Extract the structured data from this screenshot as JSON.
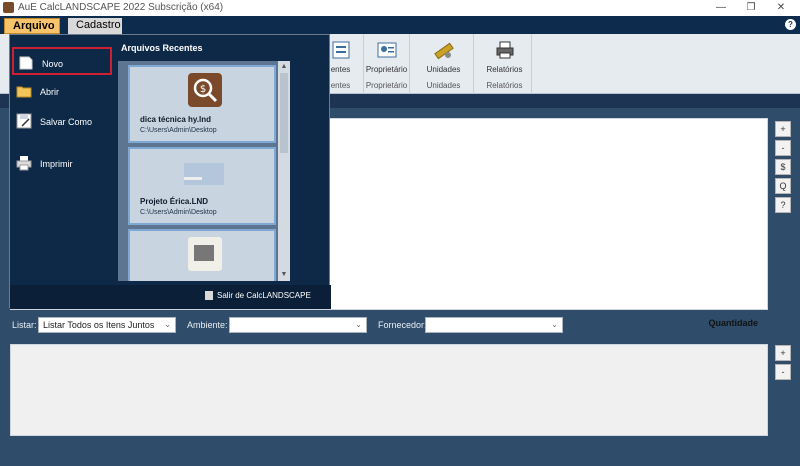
{
  "window": {
    "title": "AuE CalcLANDSCAPE 2022 Subscrição (x64)"
  },
  "tabs": [
    {
      "label": "Arquivo"
    },
    {
      "label": "Cadastro"
    }
  ],
  "ribbon": {
    "groups": [
      {
        "label": "entes",
        "group_label": "entes"
      },
      {
        "label": "Proprietário",
        "group_label": "Proprietário"
      },
      {
        "label": "Unidades",
        "group_label": "Unidades"
      },
      {
        "label": "Relatórios",
        "group_label": "Relatórios"
      }
    ]
  },
  "backstage": {
    "items": [
      {
        "label": "Novo"
      },
      {
        "label": "Abrir"
      },
      {
        "label": "Salvar Como"
      },
      {
        "label": "Imprimir"
      }
    ],
    "recent_title": "Arquivos Recentes",
    "recent_files": [
      {
        "name": "dica técnica hy.lnd",
        "path": "C:\\Users\\Admin\\Desktop"
      },
      {
        "name": "Projeto Érica.LND",
        "path": "C:\\Users\\Admin\\Desktop"
      },
      {
        "name": "",
        "path": ""
      }
    ],
    "exit_label": "Salir de CalcLANDSCAPE"
  },
  "filters": {
    "listar_label": "Listar:",
    "listar_value": "Listar Todos os Itens Juntos",
    "ambiente_label": "Ambiente:",
    "ambiente_value": "",
    "fornecedor_label": "Fornecedor:",
    "fornecedor_value": "",
    "quantidade_label": "Quantidade"
  },
  "side_buttons": {
    "top": [
      "+",
      "-",
      "$",
      "Q",
      "?"
    ],
    "bottom": [
      "+",
      "-"
    ]
  },
  "colors": {
    "accent_tab": "#f7c36b",
    "background": "#1d3553",
    "backstage": "#0e2947",
    "selection_border": "#d02030"
  }
}
